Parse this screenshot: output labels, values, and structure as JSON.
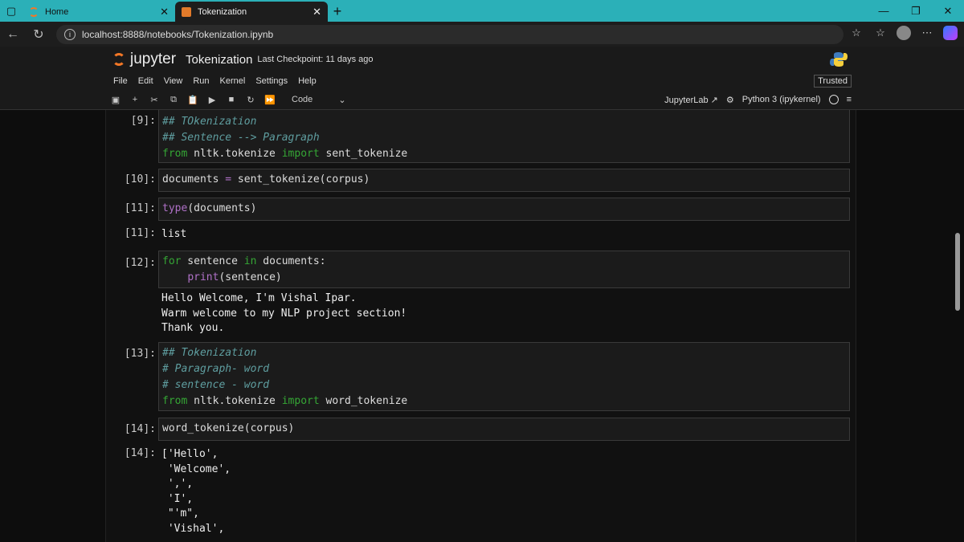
{
  "browser": {
    "tabs": [
      {
        "label": "Home",
        "active": false
      },
      {
        "label": "Tokenization",
        "active": true
      }
    ],
    "url": "localhost:8888/notebooks/Tokenization.ipynb"
  },
  "jupyter": {
    "logo_text": "jupyter",
    "notebook_title": "Tokenization",
    "checkpoint": "Last Checkpoint: 11 days ago",
    "menu": [
      "File",
      "Edit",
      "View",
      "Run",
      "Kernel",
      "Settings",
      "Help"
    ],
    "trusted": "Trusted",
    "cell_type": "Code",
    "jupyterlab_link": "JupyterLab",
    "kernel": "Python 3 (ipykernel)"
  },
  "cells": [
    {
      "prompt": "[9]:",
      "lines": [
        "## TOkenization",
        "## Sentence --> Paragraph",
        "from nltk.tokenize import sent_tokenize"
      ]
    },
    {
      "prompt": "[10]:",
      "lines": [
        "documents = sent_tokenize(corpus)"
      ]
    },
    {
      "prompt": "[11]:",
      "lines": [
        "type(documents)"
      ],
      "out_prompt": "[11]:",
      "output": "list"
    },
    {
      "prompt": "[12]:",
      "lines": [
        "for sentence in documents:",
        "    print(sentence)"
      ],
      "output": "Hello Welcome, I'm Vishal Ipar.\nWarm welcome to my NLP project section!\nThank you."
    },
    {
      "prompt": "[13]:",
      "lines": [
        "## Tokenization",
        "# Paragraph- word",
        "# sentence - word",
        "from nltk.tokenize import word_tokenize"
      ]
    },
    {
      "prompt": "[14]:",
      "lines": [
        "word_tokenize(corpus)"
      ],
      "out_prompt": "[14]:",
      "output": "['Hello',\n 'Welcome',\n ',',\n 'I',\n \"'m\",\n 'Vishal',"
    }
  ]
}
